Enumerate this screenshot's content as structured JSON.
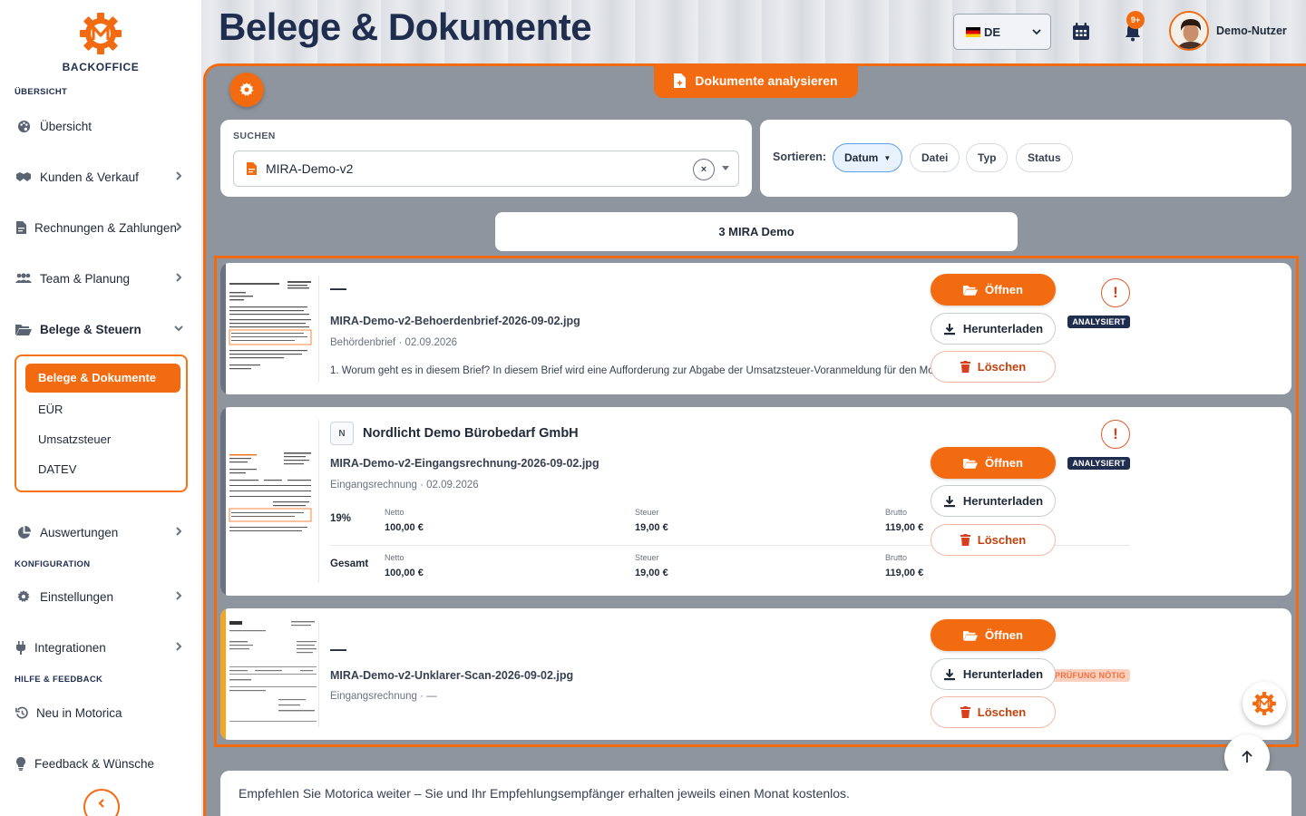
{
  "brand": {
    "name": "BACKOFFICE"
  },
  "page": {
    "title": "Belege & Dokumente"
  },
  "header": {
    "language": "DE",
    "notifications_badge": "9+",
    "user_name": "Demo-Nutzer"
  },
  "sidebar": {
    "section_overview": "ÜBERSICHT",
    "section_config": "KONFIGURATION",
    "section_help": "HILFE & FEEDBACK",
    "items": [
      {
        "label": "Übersicht",
        "icon": "palette-icon"
      },
      {
        "label": "Kunden & Verkauf",
        "icon": "handshake-icon"
      },
      {
        "label": "Rechnungen & Zahlungen",
        "icon": "invoice-icon"
      },
      {
        "label": "Team & Planung",
        "icon": "users-icon"
      },
      {
        "label": "Belege & Steuern",
        "icon": "folder-open-icon"
      },
      {
        "label": "Auswertungen",
        "icon": "pie-chart-icon"
      },
      {
        "label": "Einstellungen",
        "icon": "gear-icon"
      },
      {
        "label": "Integrationen",
        "icon": "plug-icon"
      },
      {
        "label": "Neu in Motorica",
        "icon": "history-icon"
      },
      {
        "label": "Feedback & Wünsche",
        "icon": "lightbulb-icon"
      }
    ],
    "sub_items": [
      {
        "label": "Belege & Dokumente",
        "active": true
      },
      {
        "label": "EÜR"
      },
      {
        "label": "Umsatzsteuer"
      },
      {
        "label": "DATEV"
      }
    ]
  },
  "toolbar": {
    "analyze_label": "Dokumente analysieren"
  },
  "search": {
    "label": "SUCHEN",
    "value": "MIRA-Demo-v2",
    "clear_glyph": "×"
  },
  "sort": {
    "label": "Sortieren:",
    "options": [
      {
        "label": "Datum",
        "active": true,
        "direction": "▼"
      },
      {
        "label": "Datei"
      },
      {
        "label": "Typ"
      },
      {
        "label": "Status"
      }
    ]
  },
  "group": {
    "label": "3 MIRA Demo"
  },
  "documents": [
    {
      "title": "—",
      "filename": "MIRA-Demo-v2-Behoerdenbrief-2026-09-02.jpg",
      "meta": "Behördenbrief · 02.09.2026",
      "summary": "1. Worum geht es in diesem Brief? In diesem Brief wird eine Aufforderung zur Abgabe der Umsatzsteuer-Voranmeldung für den Monat August 2026…",
      "status": "ANALYSIERT",
      "alert": "!"
    },
    {
      "company_initial": "N",
      "title": "Nordlicht Demo Bürobedarf GmbH",
      "filename": "MIRA-Demo-v2-Eingangsrechnung-2026-09-02.jpg",
      "meta": "Eingangsrechnung · 02.09.2026",
      "status": "ANALYSIERT",
      "alert": "!",
      "vat_rows": [
        {
          "rate": "19%",
          "netto_label": "Netto",
          "netto": "100,00 €",
          "steuer_label": "Steuer",
          "steuer": "19,00 €",
          "brutto_label": "Brutto",
          "brutto": "119,00 €"
        },
        {
          "rate": "Gesamt",
          "netto_label": "Netto",
          "netto": "100,00 €",
          "steuer_label": "Steuer",
          "steuer": "19,00 €",
          "brutto_label": "Brutto",
          "brutto": "119,00 €"
        }
      ]
    },
    {
      "title": "—",
      "filename": "MIRA-Demo-v2-Unklarer-Scan-2026-09-02.jpg",
      "meta": "Eingangsrechnung · —",
      "status": "PRÜFUNG NÖTIG"
    }
  ],
  "actions": {
    "open": "Öffnen",
    "download": "Herunterladen",
    "delete": "Löschen"
  },
  "footer": {
    "referral": "Empfehlen Sie Motorica weiter – Sie und Ihr Empfehlungsempfänger erhalten jeweils einen Monat kostenlos."
  },
  "colors": {
    "accent": "#f26b10",
    "navy": "#1f2d4e",
    "warning": "#f5a524"
  }
}
